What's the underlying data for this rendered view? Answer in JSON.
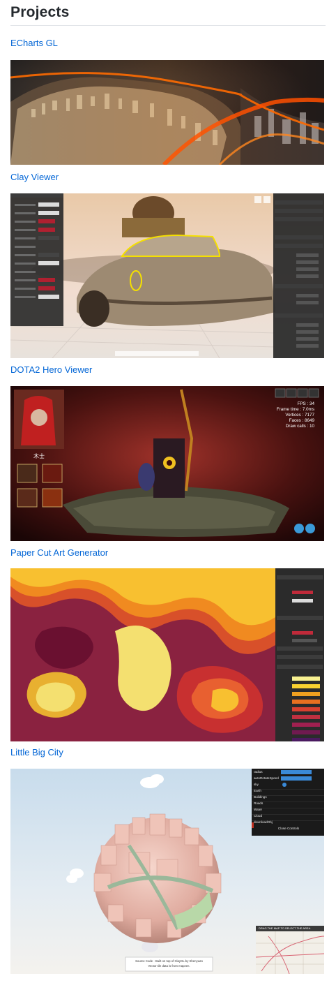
{
  "heading": "Projects",
  "projects": [
    {
      "title": "ECharts GL"
    },
    {
      "title": "Clay Viewer"
    },
    {
      "title": "DOTA2 Hero Viewer"
    },
    {
      "title": "Paper Cut Art Generator"
    },
    {
      "title": "Little Big City"
    }
  ],
  "dota": {
    "hero_name": "木士",
    "stats": [
      "FPS : 34",
      "Frame time : 7.0ms",
      "Vertices : 7177",
      "Faces : 8649",
      "Draw calls : 10"
    ]
  },
  "city": {
    "controls": [
      "radius",
      "autoRotateSpeed",
      "sky",
      "Earth",
      "Buildings",
      "Roads",
      "Water",
      "Cloud",
      "downloadObj"
    ],
    "close_controls": "Close Controls",
    "map_hint": "DRAG THE MAP TO SELECT THE AREA",
    "footer_line1": "Source Code · Built on top of ClayGL by Shenyuan",
    "footer_line2": "Vector tile data is from mapzen."
  },
  "colors": {
    "link": "#0366d6",
    "heading": "#24292e",
    "rule": "#e1e4e8"
  }
}
